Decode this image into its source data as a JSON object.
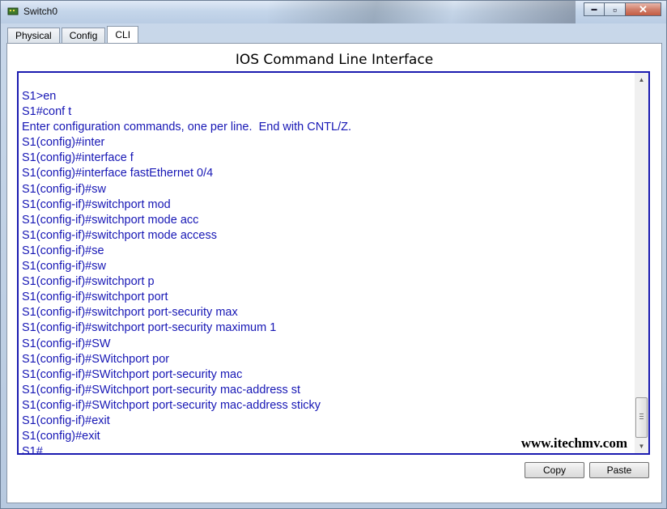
{
  "window": {
    "title": "Switch0",
    "minimize_glyph": "▬",
    "maximize_glyph": "▫",
    "close_glyph": "✕"
  },
  "tabs": [
    {
      "label": "Physical"
    },
    {
      "label": "Config"
    },
    {
      "label": "CLI",
      "active": true
    }
  ],
  "panel": {
    "title": "IOS Command Line Interface"
  },
  "console": {
    "lines": [
      "S1>en",
      "S1#conf t",
      "Enter configuration commands, one per line.  End with CNTL/Z.",
      "S1(config)#inter",
      "S1(config)#interface f",
      "S1(config)#interface fastEthernet 0/4",
      "S1(config-if)#sw",
      "S1(config-if)#switchport mod",
      "S1(config-if)#switchport mode acc",
      "S1(config-if)#switchport mode access",
      "S1(config-if)#se",
      "S1(config-if)#sw",
      "S1(config-if)#switchport p",
      "S1(config-if)#switchport port",
      "S1(config-if)#switchport port-security max",
      "S1(config-if)#switchport port-security maximum 1",
      "S1(config-if)#SW",
      "S1(config-if)#SWitchport por",
      "S1(config-if)#SWitchport port-security mac",
      "S1(config-if)#SWitchport port-security mac-address st",
      "S1(config-if)#SWitchport port-security mac-address sticky",
      "S1(config-if)#exit",
      "S1(config)#exit",
      "S1#"
    ],
    "text_color": "#1717b5",
    "border_color": "#1b1bb0"
  },
  "watermark": "www.itechmv.com",
  "buttons": {
    "copy_label": "Copy",
    "paste_label": "Paste"
  }
}
